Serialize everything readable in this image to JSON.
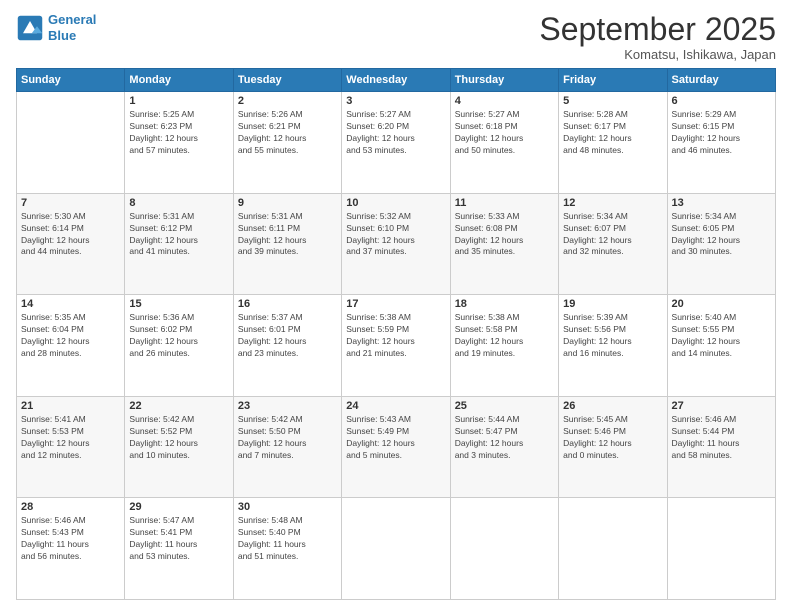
{
  "logo": {
    "line1": "General",
    "line2": "Blue"
  },
  "title": "September 2025",
  "location": "Komatsu, Ishikawa, Japan",
  "days_header": [
    "Sunday",
    "Monday",
    "Tuesday",
    "Wednesday",
    "Thursday",
    "Friday",
    "Saturday"
  ],
  "weeks": [
    [
      {
        "num": "",
        "info": ""
      },
      {
        "num": "1",
        "info": "Sunrise: 5:25 AM\nSunset: 6:23 PM\nDaylight: 12 hours\nand 57 minutes."
      },
      {
        "num": "2",
        "info": "Sunrise: 5:26 AM\nSunset: 6:21 PM\nDaylight: 12 hours\nand 55 minutes."
      },
      {
        "num": "3",
        "info": "Sunrise: 5:27 AM\nSunset: 6:20 PM\nDaylight: 12 hours\nand 53 minutes."
      },
      {
        "num": "4",
        "info": "Sunrise: 5:27 AM\nSunset: 6:18 PM\nDaylight: 12 hours\nand 50 minutes."
      },
      {
        "num": "5",
        "info": "Sunrise: 5:28 AM\nSunset: 6:17 PM\nDaylight: 12 hours\nand 48 minutes."
      },
      {
        "num": "6",
        "info": "Sunrise: 5:29 AM\nSunset: 6:15 PM\nDaylight: 12 hours\nand 46 minutes."
      }
    ],
    [
      {
        "num": "7",
        "info": "Sunrise: 5:30 AM\nSunset: 6:14 PM\nDaylight: 12 hours\nand 44 minutes."
      },
      {
        "num": "8",
        "info": "Sunrise: 5:31 AM\nSunset: 6:12 PM\nDaylight: 12 hours\nand 41 minutes."
      },
      {
        "num": "9",
        "info": "Sunrise: 5:31 AM\nSunset: 6:11 PM\nDaylight: 12 hours\nand 39 minutes."
      },
      {
        "num": "10",
        "info": "Sunrise: 5:32 AM\nSunset: 6:10 PM\nDaylight: 12 hours\nand 37 minutes."
      },
      {
        "num": "11",
        "info": "Sunrise: 5:33 AM\nSunset: 6:08 PM\nDaylight: 12 hours\nand 35 minutes."
      },
      {
        "num": "12",
        "info": "Sunrise: 5:34 AM\nSunset: 6:07 PM\nDaylight: 12 hours\nand 32 minutes."
      },
      {
        "num": "13",
        "info": "Sunrise: 5:34 AM\nSunset: 6:05 PM\nDaylight: 12 hours\nand 30 minutes."
      }
    ],
    [
      {
        "num": "14",
        "info": "Sunrise: 5:35 AM\nSunset: 6:04 PM\nDaylight: 12 hours\nand 28 minutes."
      },
      {
        "num": "15",
        "info": "Sunrise: 5:36 AM\nSunset: 6:02 PM\nDaylight: 12 hours\nand 26 minutes."
      },
      {
        "num": "16",
        "info": "Sunrise: 5:37 AM\nSunset: 6:01 PM\nDaylight: 12 hours\nand 23 minutes."
      },
      {
        "num": "17",
        "info": "Sunrise: 5:38 AM\nSunset: 5:59 PM\nDaylight: 12 hours\nand 21 minutes."
      },
      {
        "num": "18",
        "info": "Sunrise: 5:38 AM\nSunset: 5:58 PM\nDaylight: 12 hours\nand 19 minutes."
      },
      {
        "num": "19",
        "info": "Sunrise: 5:39 AM\nSunset: 5:56 PM\nDaylight: 12 hours\nand 16 minutes."
      },
      {
        "num": "20",
        "info": "Sunrise: 5:40 AM\nSunset: 5:55 PM\nDaylight: 12 hours\nand 14 minutes."
      }
    ],
    [
      {
        "num": "21",
        "info": "Sunrise: 5:41 AM\nSunset: 5:53 PM\nDaylight: 12 hours\nand 12 minutes."
      },
      {
        "num": "22",
        "info": "Sunrise: 5:42 AM\nSunset: 5:52 PM\nDaylight: 12 hours\nand 10 minutes."
      },
      {
        "num": "23",
        "info": "Sunrise: 5:42 AM\nSunset: 5:50 PM\nDaylight: 12 hours\nand 7 minutes."
      },
      {
        "num": "24",
        "info": "Sunrise: 5:43 AM\nSunset: 5:49 PM\nDaylight: 12 hours\nand 5 minutes."
      },
      {
        "num": "25",
        "info": "Sunrise: 5:44 AM\nSunset: 5:47 PM\nDaylight: 12 hours\nand 3 minutes."
      },
      {
        "num": "26",
        "info": "Sunrise: 5:45 AM\nSunset: 5:46 PM\nDaylight: 12 hours\nand 0 minutes."
      },
      {
        "num": "27",
        "info": "Sunrise: 5:46 AM\nSunset: 5:44 PM\nDaylight: 11 hours\nand 58 minutes."
      }
    ],
    [
      {
        "num": "28",
        "info": "Sunrise: 5:46 AM\nSunset: 5:43 PM\nDaylight: 11 hours\nand 56 minutes."
      },
      {
        "num": "29",
        "info": "Sunrise: 5:47 AM\nSunset: 5:41 PM\nDaylight: 11 hours\nand 53 minutes."
      },
      {
        "num": "30",
        "info": "Sunrise: 5:48 AM\nSunset: 5:40 PM\nDaylight: 11 hours\nand 51 minutes."
      },
      {
        "num": "",
        "info": ""
      },
      {
        "num": "",
        "info": ""
      },
      {
        "num": "",
        "info": ""
      },
      {
        "num": "",
        "info": ""
      }
    ]
  ]
}
